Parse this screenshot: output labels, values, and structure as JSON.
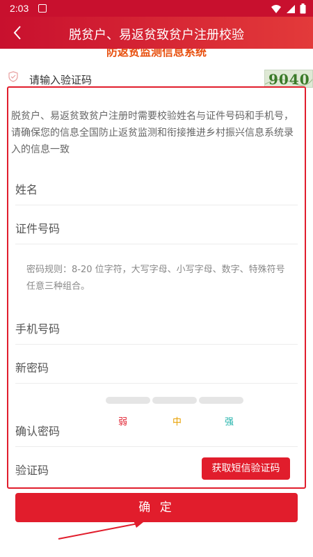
{
  "status_bar": {
    "time": "2:03"
  },
  "title_bar": {
    "title": "脱贫户、易返贫致贫户注册校验"
  },
  "header": {
    "system_title": "防返贫监测信息系统"
  },
  "captcha": {
    "placeholder": "请输入验证码",
    "image_text": "9040"
  },
  "notice": {
    "text": "脱贫户、易返贫致贫户注册时需要校验姓名与证件号码和手机号，请确保您的信息全国防止返贫监测和衔接推进乡村振兴信息系统录入的信息一致"
  },
  "form": {
    "name_label": "姓名",
    "id_label": "证件号码",
    "password_rule": "密码规则：8-20 位字符，大写字母、小写字母、数字、特殊符号任意三种组合。",
    "phone_label": "手机号码",
    "new_password_label": "新密码",
    "confirm_password_label": "确认密码",
    "verify_code_label": "验证码",
    "sms_button": "获取短信验证码"
  },
  "strength": {
    "weak": "弱",
    "medium": "中",
    "strong": "强",
    "colors": {
      "weak": "#e11d2c",
      "medium": "#e8a000",
      "strong": "#20b2aa"
    }
  },
  "confirm_button": "确 定",
  "colors": {
    "primary": "#e11d2c",
    "accent": "#e8500f"
  }
}
